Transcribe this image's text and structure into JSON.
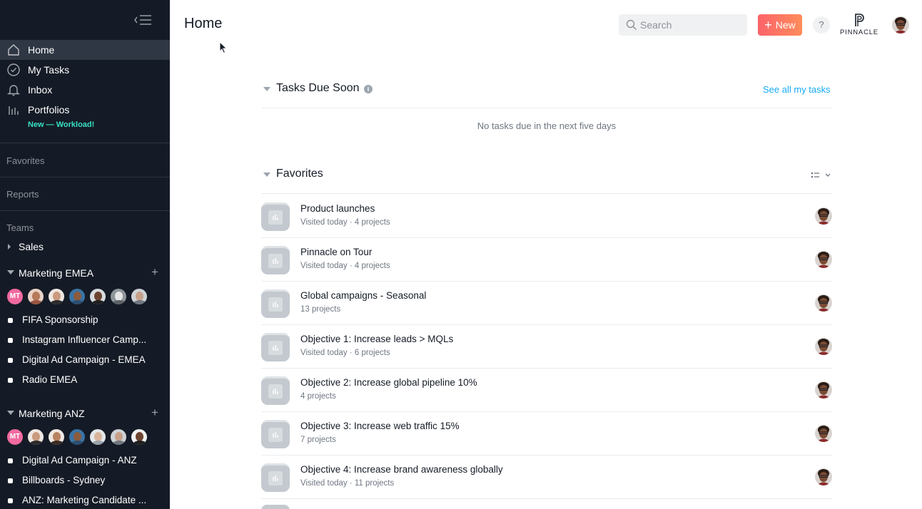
{
  "sidebar": {
    "nav": [
      {
        "label": "Home",
        "icon": "home-icon",
        "active": true
      },
      {
        "label": "My Tasks",
        "icon": "check-circle-icon"
      },
      {
        "label": "Inbox",
        "icon": "bell-icon"
      },
      {
        "label": "Portfolios",
        "icon": "bar-chart-icon"
      }
    ],
    "portfolios_promo": "New — Workload!",
    "favorites_heading": "Favorites",
    "reports_heading": "Reports",
    "teams_heading": "Teams",
    "teams": [
      {
        "name": "Sales",
        "expanded": false
      },
      {
        "name": "Marketing EMEA",
        "expanded": true,
        "member_initials": "MT",
        "projects": [
          "FIFA Sponsorship",
          "Instagram Influencer Camp...",
          "Digital Ad Campaign - EMEA",
          "Radio EMEA"
        ]
      },
      {
        "name": "Marketing ANZ",
        "expanded": true,
        "member_initials": "MT",
        "projects": [
          "Digital Ad Campaign - ANZ",
          "Billboards - Sydney",
          "ANZ: Marketing Candidate ..."
        ]
      }
    ]
  },
  "header": {
    "title": "Home",
    "search_placeholder": "Search",
    "new_button": "New",
    "help_label": "?",
    "org_name": "PINNACLE"
  },
  "tasks_due": {
    "title": "Tasks Due Soon",
    "info_label": "i",
    "see_all": "See all my tasks",
    "empty_message": "No tasks due in the next five days"
  },
  "favorites": {
    "title": "Favorites",
    "items": [
      {
        "name": "Product launches",
        "meta": "Visited today · 4 projects"
      },
      {
        "name": "Pinnacle on Tour",
        "meta": "Visited today · 4 projects"
      },
      {
        "name": "Global campaigns - Seasonal",
        "meta": "13 projects"
      },
      {
        "name": "Objective 1: Increase leads > MQLs",
        "meta": "Visited today · 6 projects"
      },
      {
        "name": "Objective 2: Increase global pipeline 10%",
        "meta": "4 projects"
      },
      {
        "name": "Objective 3: Increase web traffic 15%",
        "meta": "7 projects"
      },
      {
        "name": "Objective 4: Increase brand awareness globally",
        "meta": "Visited today · 11 projects"
      }
    ]
  },
  "colors": {
    "sidebar_bg": "#151b26",
    "sidebar_active": "#2f3744",
    "promo_accent": "#37e1c4",
    "link_blue": "#14aaf5",
    "new_button_start": "#fc636b",
    "new_button_end": "#ff8c5a",
    "avatar_mt": "#f06a9f"
  }
}
